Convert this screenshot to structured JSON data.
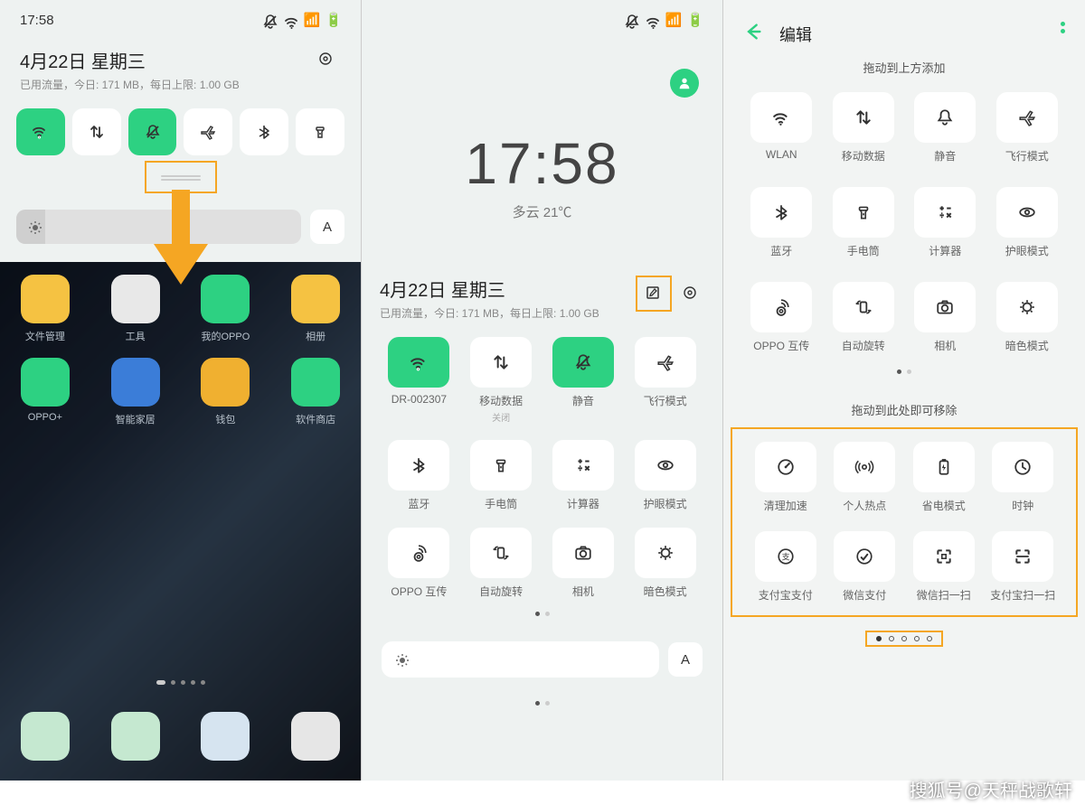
{
  "status": {
    "time": "17:58"
  },
  "s1": {
    "date": "4月22日  星期三",
    "usage": "已用流量，今日: 171 MB，每日上限: 1.00 GB",
    "autoA": "A",
    "apps1": [
      "文件管理",
      "工具",
      "我的OPPO",
      "相册"
    ],
    "apps2": [
      "OPPO+",
      "智能家居",
      "钱包",
      "软件商店"
    ]
  },
  "s2": {
    "clock": "17:58",
    "weather": "多云 21℃",
    "date": "4月22日  星期三",
    "usage": "已用流量，今日: 171 MB，每日上限: 1.00 GB",
    "tiles": [
      {
        "lbl": "DR-002307",
        "sub": "",
        "on": true,
        "icon": "wifi"
      },
      {
        "lbl": "移动数据",
        "sub": "关闭",
        "on": false,
        "icon": "data"
      },
      {
        "lbl": "静音",
        "sub": "",
        "on": true,
        "icon": "mute"
      },
      {
        "lbl": "飞行模式",
        "sub": "",
        "on": false,
        "icon": "plane"
      },
      {
        "lbl": "蓝牙",
        "sub": "",
        "on": false,
        "icon": "bt"
      },
      {
        "lbl": "手电筒",
        "sub": "",
        "on": false,
        "icon": "torch"
      },
      {
        "lbl": "计算器",
        "sub": "",
        "on": false,
        "icon": "calc"
      },
      {
        "lbl": "护眼模式",
        "sub": "",
        "on": false,
        "icon": "eye"
      },
      {
        "lbl": "OPPO 互传",
        "sub": "",
        "on": false,
        "icon": "share"
      },
      {
        "lbl": "自动旋转",
        "sub": "",
        "on": false,
        "icon": "rotate"
      },
      {
        "lbl": "相机",
        "sub": "",
        "on": false,
        "icon": "camera"
      },
      {
        "lbl": "暗色模式",
        "sub": "",
        "on": false,
        "icon": "dark"
      }
    ],
    "autoA": "A"
  },
  "s3": {
    "title": "编辑",
    "addLbl": "拖动到上方添加",
    "removeLbl": "拖动到此处即可移除",
    "top": [
      {
        "lbl": "WLAN",
        "icon": "wifi"
      },
      {
        "lbl": "移动数据",
        "icon": "data"
      },
      {
        "lbl": "静音",
        "icon": "bell"
      },
      {
        "lbl": "飞行模式",
        "icon": "plane"
      },
      {
        "lbl": "蓝牙",
        "icon": "bt"
      },
      {
        "lbl": "手电筒",
        "icon": "torch"
      },
      {
        "lbl": "计算器",
        "icon": "calc"
      },
      {
        "lbl": "护眼模式",
        "icon": "eye"
      },
      {
        "lbl": "OPPO 互传",
        "icon": "share"
      },
      {
        "lbl": "自动旋转",
        "icon": "rotate"
      },
      {
        "lbl": "相机",
        "icon": "camera"
      },
      {
        "lbl": "暗色模式",
        "icon": "dark"
      }
    ],
    "bottom": [
      {
        "lbl": "清理加速",
        "icon": "speed"
      },
      {
        "lbl": "个人热点",
        "icon": "hotspot"
      },
      {
        "lbl": "省电模式",
        "icon": "battery"
      },
      {
        "lbl": "时钟",
        "icon": "clock"
      },
      {
        "lbl": "支付宝支付",
        "icon": "alipay"
      },
      {
        "lbl": "微信支付",
        "icon": "wechat"
      },
      {
        "lbl": "微信扫一扫",
        "icon": "scan"
      },
      {
        "lbl": "支付宝扫一扫",
        "icon": "scan2"
      }
    ]
  },
  "watermark": "搜狐号@天秤战歌轩"
}
